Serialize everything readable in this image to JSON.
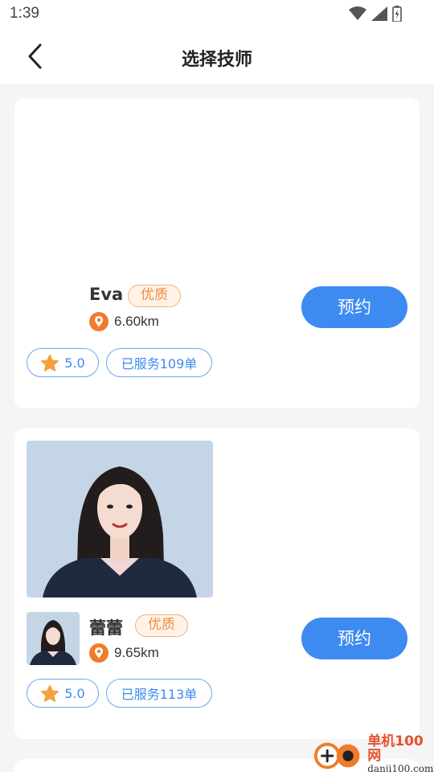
{
  "status": {
    "time": "1:39"
  },
  "header": {
    "title": "选择技师"
  },
  "technicians": [
    {
      "name": "Eva",
      "badge": "优质",
      "distance": "6.60km",
      "book_label": "预约",
      "rating": "5.0",
      "served": "已服务109单"
    },
    {
      "name": "蕾蕾",
      "badge": "优质",
      "distance": "9.65km",
      "book_label": "预约",
      "rating": "5.0",
      "served": "已服务113单"
    }
  ],
  "watermark": {
    "title": "单机100网",
    "url": "danji100.com"
  },
  "colors": {
    "accent": "#3d8bf0",
    "badge": "#f08c3e",
    "location": "#f07b2a",
    "star": "#f5a03c"
  }
}
